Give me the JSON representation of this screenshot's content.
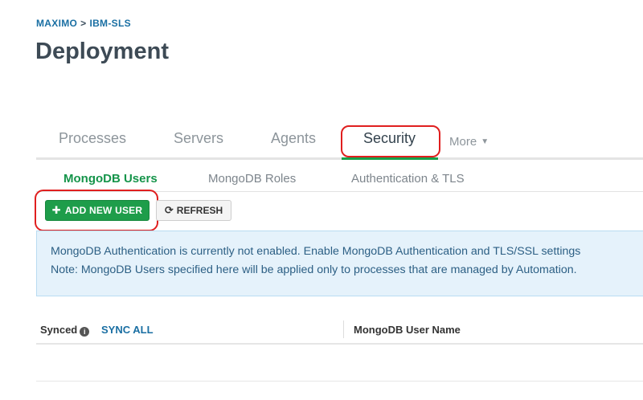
{
  "breadcrumb": {
    "org": "MAXIMO",
    "separator": ">",
    "project": "IBM-SLS"
  },
  "page_title": "Deployment",
  "main_tabs": [
    {
      "label": "Processes",
      "active": false
    },
    {
      "label": "Servers",
      "active": false
    },
    {
      "label": "Agents",
      "active": false
    },
    {
      "label": "Security",
      "active": true
    }
  ],
  "more_tab": {
    "label": "More"
  },
  "sub_tabs": [
    {
      "label": "MongoDB Users",
      "active": true
    },
    {
      "label": "MongoDB Roles",
      "active": false
    },
    {
      "label": "Authentication & TLS",
      "active": false
    }
  ],
  "toolbar": {
    "add_user_label": "ADD NEW USER",
    "refresh_label": "REFRESH"
  },
  "info_banner": {
    "line1": "MongoDB Authentication is currently not enabled. Enable MongoDB Authentication and TLS/SSL settings",
    "line2": "Note: MongoDB Users specified here will be applied only to processes that are managed by Automation."
  },
  "table": {
    "synced_header": "Synced",
    "sync_all_label": "SYNC ALL",
    "username_header": "MongoDB User Name"
  },
  "colors": {
    "accent_green": "#1e9d4a",
    "link_blue": "#1a6fa3",
    "highlight_red": "#e01f1f",
    "banner_bg": "#e5f2fb"
  },
  "icons": {
    "add": "plus-icon",
    "refresh": "refresh-icon",
    "more": "chevron-down-icon",
    "info": "info-icon"
  }
}
